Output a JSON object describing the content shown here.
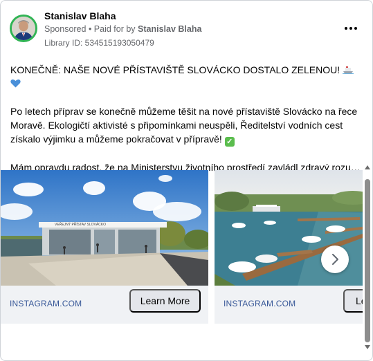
{
  "post": {
    "author": "Stanislav Blaha",
    "sponsored": "Sponsored",
    "paid_for": "• Paid for by",
    "payer": "Stanislav Blaha",
    "library_id": "Library ID: 534515193050479",
    "more_icon": "more-horizontal-icon",
    "text": {
      "headline": "KONEČNĚ: NAŠE NOVÉ PŘÍSTAVIŠTĚ SLOVÁCKO DOSTALO ZELENOU!",
      "paragraph": "Po letech příprav se konečně můžeme těšit na nové přístaviště Slovácko na řece Moravě. Ekologičtí aktivisté s připomínkami neuspěli, Ředitelství vodních cest získalo výjimku a můžeme pokračovat v přípravě!",
      "last": "Mám opravdu radost, že na Ministerstvu životního prostředí zavládl zdravý rozum..."
    }
  },
  "carousel": {
    "cards": [
      {
        "domain": "INSTAGRAM.COM",
        "cta": "Learn More",
        "image_sign": "VEŘEJNÝ PŘÍSTAV SLOVÁCKO"
      },
      {
        "domain": "INSTAGRAM.COM",
        "cta": "Le"
      }
    ],
    "next_icon": "chevron-right-icon"
  },
  "colors": {
    "avatar_ring": "#31b454",
    "link_blue": "#385898",
    "button_bg": "#e4e6eb"
  }
}
